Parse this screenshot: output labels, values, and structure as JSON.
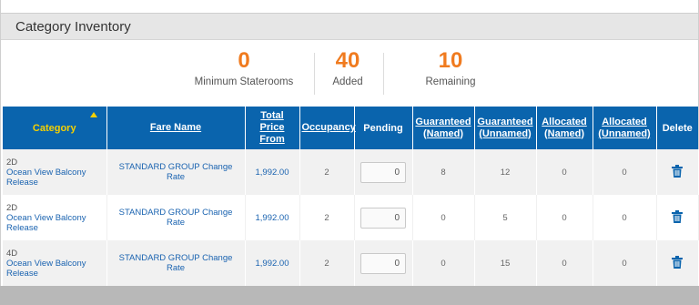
{
  "panel": {
    "title": "Category Inventory"
  },
  "summary": {
    "minimum": {
      "value": "0",
      "label": "Minimum Staterooms"
    },
    "added": {
      "value": "40",
      "label": "Added"
    },
    "remaining": {
      "value": "10",
      "label": "Remaining"
    }
  },
  "table": {
    "headers": {
      "category": "Category",
      "fare_name": "Fare Name",
      "total_price_line1": "Total Price",
      "total_price_line2": "From",
      "occupancy": "Occupancy",
      "pending": "Pending",
      "guaranteed_named_line1": "Guaranteed",
      "guaranteed_named_line2": "(Named)",
      "guaranteed_unnamed_line1": "Guaranteed",
      "guaranteed_unnamed_line2": "(Unnamed)",
      "allocated_named_line1": "Allocated",
      "allocated_named_line2": "(Named)",
      "allocated_unnamed_line1": "Allocated",
      "allocated_unnamed_line2": "(Unnamed)",
      "delete": "Delete"
    },
    "rows": [
      {
        "code": "2D",
        "name_line1": "Ocean View Balcony",
        "name_line2": "Release",
        "fare": "STANDARD GROUP Change Rate",
        "price": "1,992.00",
        "occupancy": "2",
        "pending": "0",
        "gn": "8",
        "gu": "12",
        "an": "0",
        "au": "0"
      },
      {
        "code": "2D",
        "name_line1": "Ocean View Balcony",
        "name_line2": "Release",
        "fare": "STANDARD GROUP Change Rate",
        "price": "1,992.00",
        "occupancy": "2",
        "pending": "0",
        "gn": "0",
        "gu": "5",
        "an": "0",
        "au": "0"
      },
      {
        "code": "4D",
        "name_line1": "Ocean View Balcony",
        "name_line2": "Release",
        "fare": "STANDARD GROUP Change Rate",
        "price": "1,992.00",
        "occupancy": "2",
        "pending": "0",
        "gn": "0",
        "gu": "15",
        "an": "0",
        "au": "0"
      }
    ]
  },
  "colors": {
    "header_blue": "#0a64ad",
    "accent_orange": "#f07b1f",
    "sort_yellow": "#f5d000",
    "link_blue": "#1a63b0"
  },
  "icons": {
    "delete": "trash-icon",
    "sort": "sort-ascending-icon"
  }
}
